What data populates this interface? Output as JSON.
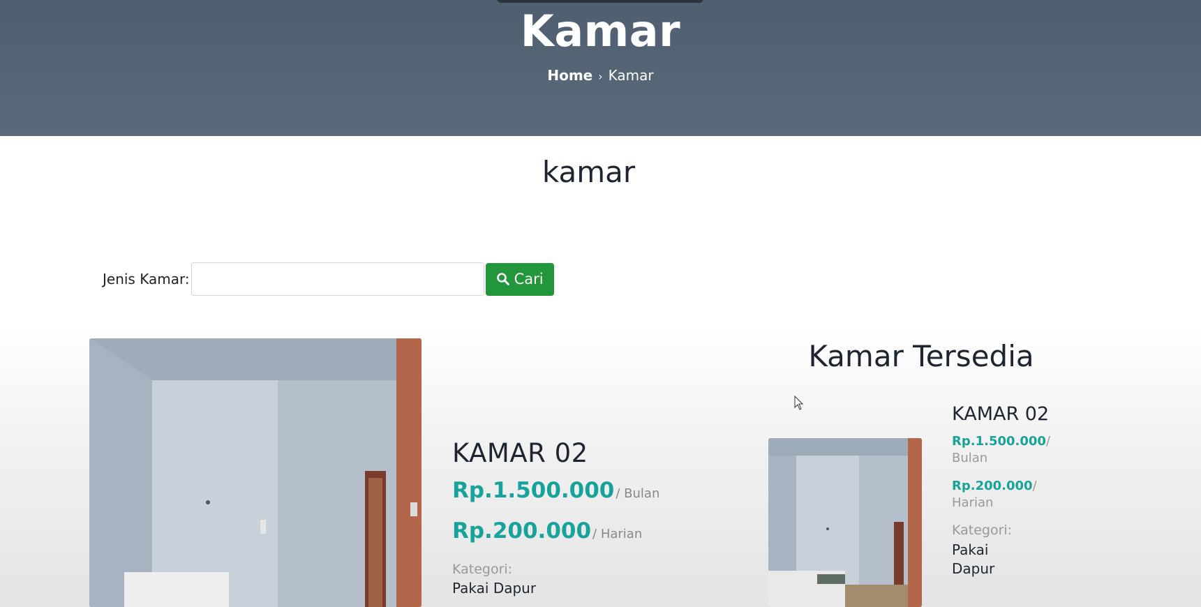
{
  "hero": {
    "title": "Kamar",
    "breadcrumb": {
      "home": "Home",
      "separator": "›",
      "current": "Kamar"
    }
  },
  "section": {
    "title": "kamar"
  },
  "search": {
    "label": "Jenis Kamar:",
    "value": "",
    "placeholder": "",
    "button_label": "Cari",
    "button_icon": "search-icon",
    "button_color": "#21963a"
  },
  "featured_room": {
    "name": "KAMAR 02",
    "monthly_price": "Rp.1.500.000",
    "monthly_unit": "/ Bulan",
    "daily_price": "Rp.200.000",
    "daily_unit": "/ Harian",
    "category_label": "Kategori:",
    "category_value": "Pakai Dapur"
  },
  "sidebar": {
    "title": "Kamar Tersedia",
    "room": {
      "name": "KAMAR 02",
      "monthly_price": "Rp.1.500.000",
      "monthly_unit": "/ Bulan",
      "daily_price": "Rp.200.000",
      "daily_unit": "/ Harian",
      "category_label": "Kategori:",
      "category_value": "Pakai Dapur"
    }
  },
  "colors": {
    "hero_bg": "#56667a",
    "price": "#17a39a",
    "button": "#21963a"
  }
}
